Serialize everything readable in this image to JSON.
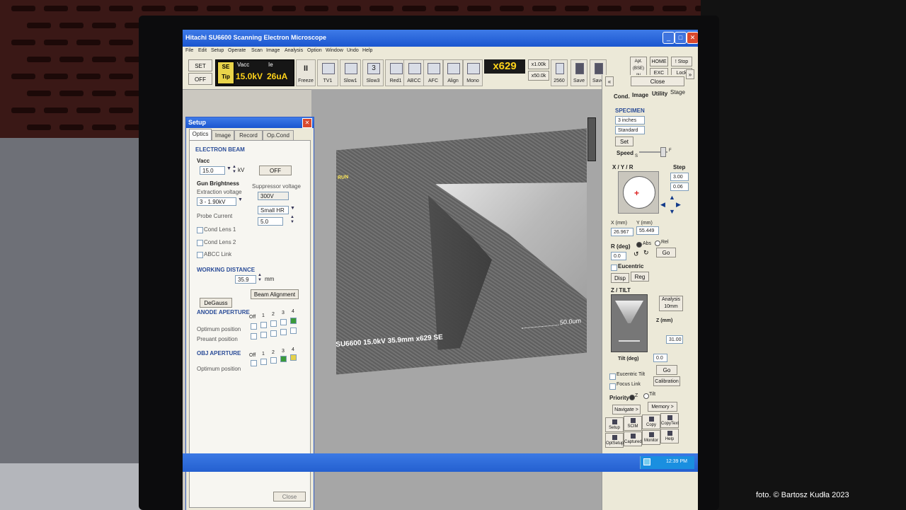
{
  "window": {
    "title": "Hitachi SU6600 Scanning Electron Microscope"
  },
  "menu": [
    "File",
    "Edit",
    "Setup",
    "Operate",
    "Scan",
    "Image",
    "Analysis",
    "Option",
    "Window",
    "Undo",
    "Help"
  ],
  "toolbar": {
    "set_label": "SET",
    "off_label": "OFF",
    "se_label": "SE",
    "tip_label": "Tip",
    "vacc_caption": "Vacc",
    "ie_caption": "Ie",
    "vacc_value": "15.0kV",
    "ie_value": "26uA",
    "buttons": [
      "Freeze",
      "TV1",
      "Slow1",
      "Slow3",
      "Red1",
      "ABCC",
      "AFC",
      "Align",
      "Mono"
    ],
    "slow3_number": "3",
    "mag_value": "x629",
    "mag_x1k": "x1.00k",
    "mag_x50k": "x50.0k",
    "res_label": "2560",
    "save1": "Save",
    "save2": "Save",
    "apt_label": "Apt.",
    "bse_label": "(BSE)",
    "in_label": "IN",
    "home_label": "HOME",
    "exc_label": "EXC",
    "stop_label": "! Stop",
    "lock_label": "Lock"
  },
  "setup": {
    "title": "Setup",
    "tabs": [
      "Optics",
      "Image",
      "Record",
      "Op.Cond"
    ],
    "electron_beam": "ELECTRON BEAM",
    "vacc_label": "Vacc",
    "vacc_value": "15.0",
    "vacc_unit": "kV",
    "off_button": "OFF",
    "gun_brightness": "Gun Brightness",
    "extraction_voltage": "Extraction voltage",
    "suppressor_voltage": "Suppressor voltage",
    "extraction_value": "3 - 1.90kV",
    "suppressor_value": "300V",
    "probe_current": "Probe Current",
    "probe_mode": "Small HR",
    "probe_value": "5.0",
    "cond_lens_1": "Cond Lens 1",
    "cond_lens_2": "Cond Lens 2",
    "abcc_link": "ABCC Link",
    "working_distance": "WORKING DISTANCE",
    "wd_value": "35.9",
    "wd_unit": "mm",
    "degauss": "DeGauss",
    "beam_alignment": "Beam Alignment",
    "anode_aperture": "ANODE APERTURE",
    "aperture_cols": [
      "Off",
      "1",
      "2",
      "3",
      "4"
    ],
    "optimum_position": "Optimum position",
    "preuant_position": "Preuant position",
    "obj_aperture": "OBJ APERTURE",
    "optimum_position2": "Optimum position",
    "close": "Close"
  },
  "image": {
    "run_label": "RUN",
    "info_bar": "SU6600 15.0kV 35.9mm x629 SE",
    "scale_label": "50.0um"
  },
  "stage": {
    "close": "Close",
    "tabs": [
      "Cond.",
      "Image",
      "Utility",
      "Stage"
    ],
    "specimen": "SPECIMEN",
    "size": "3 inches",
    "holder": "Standard",
    "set": "Set",
    "speed": "Speed",
    "speed_s": "S",
    "speed_f": "F",
    "xyr": "X / Y / R",
    "step": "Step",
    "step_x": "3.00",
    "step_y": "0.06",
    "x_label": "X (mm)",
    "y_label": "Y (mm)",
    "x_value": "26.967",
    "y_value": "55.449",
    "r_label": "R (deg)",
    "abs": "Abs",
    "rel": "Rel",
    "r_value": "0.0",
    "go": "Go",
    "eucentric": "Eucentric",
    "disp": "Disp",
    "reg": "Reg",
    "ztilt": "Z / TILT",
    "analysis": "Analysis",
    "analysis_mm": "10mm",
    "z_mm": "Z (mm)",
    "z_value": "31.00",
    "tilt_label": "Tilt (deg)",
    "tilt_value": "0.0",
    "go2": "Go",
    "eucentric_tilt": "Eucentric Tilt",
    "focus_link": "Focus Link",
    "calibration": "Calibration",
    "priority": "Priority",
    "prio_z": "Z",
    "prio_tilt": "Tilt",
    "navigate": "Navigate >",
    "memory": "Memory >",
    "tools": [
      "Setup",
      "SCIM",
      "Copy",
      "CopyText",
      "OptSetup",
      "Captured",
      "Monitor",
      "Help"
    ]
  },
  "taskbar": {
    "time": "12:39 PM"
  },
  "photo_credit": "foto. © Bartosz Kudła 2023"
}
